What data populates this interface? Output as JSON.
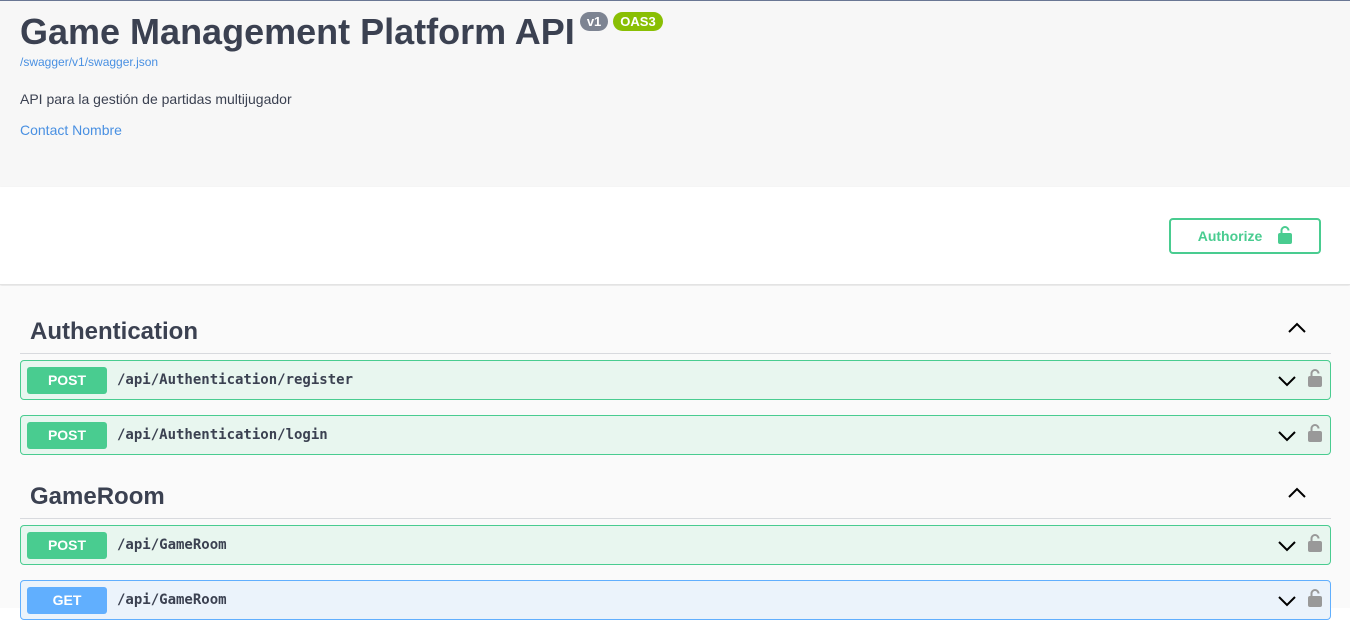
{
  "info": {
    "title": "Game Management Platform API",
    "version_badge": "v1",
    "oas_badge": "OAS3",
    "spec_url": "/swagger/v1/swagger.json",
    "description": "API para la gestión de partidas multijugador",
    "contact": "Contact Nombre"
  },
  "scheme": {
    "authorize_label": "Authorize",
    "authorize_icon": "unlock-icon"
  },
  "tags": [
    {
      "name": "Authentication",
      "expanded": true,
      "operations": [
        {
          "method": "POST",
          "path": "/api/Authentication/register"
        },
        {
          "method": "POST",
          "path": "/api/Authentication/login"
        }
      ]
    },
    {
      "name": "GameRoom",
      "expanded": true,
      "operations": [
        {
          "method": "POST",
          "path": "/api/GameRoom"
        },
        {
          "method": "GET",
          "path": "/api/GameRoom"
        }
      ]
    }
  ],
  "colors": {
    "post": "#49cc90",
    "get": "#61affe",
    "link": "#4990e2",
    "oas_badge": "#89bf04",
    "version_badge": "#7d8492"
  }
}
